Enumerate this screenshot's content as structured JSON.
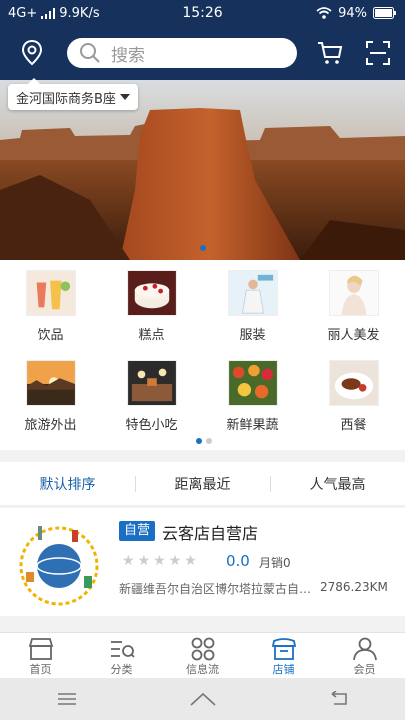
{
  "status": {
    "network": "4G+",
    "speed": "9.9K/s",
    "time": "15:26",
    "battery": "94%"
  },
  "header": {
    "search_placeholder": "搜索"
  },
  "location": {
    "label": "金河国际商务B座"
  },
  "categories": [
    {
      "label": "饮品"
    },
    {
      "label": "糕点"
    },
    {
      "label": "服装"
    },
    {
      "label": "丽人美发"
    },
    {
      "label": "旅游外出"
    },
    {
      "label": "特色小吃"
    },
    {
      "label": "新鲜果蔬"
    },
    {
      "label": "西餐"
    }
  ],
  "sort": {
    "options": [
      "默认排序",
      "距离最近",
      "人气最高"
    ]
  },
  "shop": {
    "tag": "自营",
    "name": "云客店自营店",
    "rating": "0.0",
    "sales": "月销0",
    "address": "新疆维吾尔自治区博尔塔拉蒙古自治州",
    "distance": "2786.23KM"
  },
  "tabs": [
    {
      "label": "首页"
    },
    {
      "label": "分类"
    },
    {
      "label": "信息流"
    },
    {
      "label": "店铺"
    },
    {
      "label": "会员"
    }
  ],
  "colors": {
    "header_bg": "#16325c",
    "accent": "#1a6fc4"
  }
}
